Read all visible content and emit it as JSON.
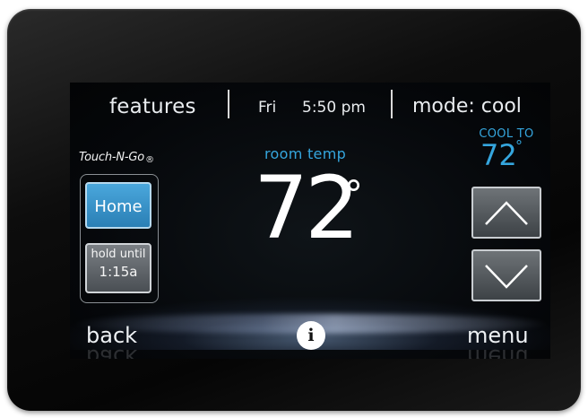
{
  "header": {
    "features_label": "features",
    "day": "Fri",
    "time": "5:50 pm",
    "mode_label": "mode: cool"
  },
  "setpoint": {
    "label": "COOL TO",
    "value": "72",
    "unit": "°"
  },
  "brand": {
    "name": "Touch-N-Go",
    "registered": "®"
  },
  "left_panel": {
    "home_label": "Home",
    "hold_line1": "hold until",
    "hold_line2": "1:15a"
  },
  "room": {
    "label": "room temp",
    "value": "72",
    "unit": "°"
  },
  "footer": {
    "back_label": "back",
    "info_label": "i",
    "menu_label": "menu"
  },
  "icons": {
    "up": "chevron-up-icon",
    "down": "chevron-down-icon",
    "info": "info-icon"
  },
  "colors": {
    "accent": "#35a6de",
    "home_button": "#2a7fb5",
    "screen_bg": "#05070a"
  }
}
